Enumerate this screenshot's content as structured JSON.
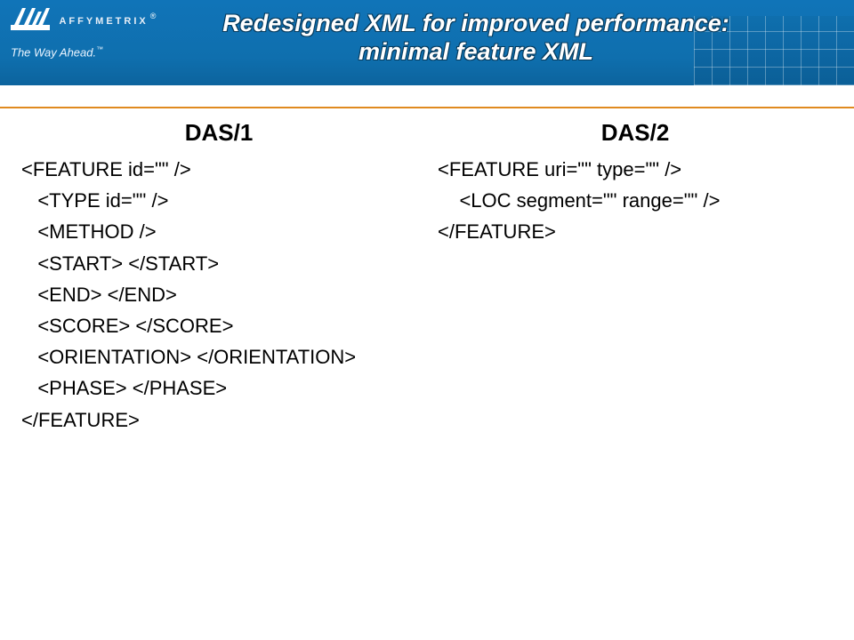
{
  "brand": {
    "word": "AFFYMETRIX",
    "registered": "®",
    "tagline": "The Way Ahead.",
    "tm": "™"
  },
  "title_line1": "Redesigned XML for improved performance:",
  "title_line2": "minimal feature XML",
  "left": {
    "heading": "DAS/1",
    "code": "<FEATURE id=\"\" />\n   <TYPE id=\"\" />\n   <METHOD />\n   <START> </START>\n   <END> </END>\n   <SCORE> </SCORE>\n   <ORIENTATION> </ORIENTATION>\n   <PHASE> </PHASE>\n</FEATURE>"
  },
  "right": {
    "heading": "DAS/2",
    "code": "<FEATURE uri=\"\" type=\"\" />\n    <LOC segment=\"\" range=\"\" />\n</FEATURE>"
  }
}
